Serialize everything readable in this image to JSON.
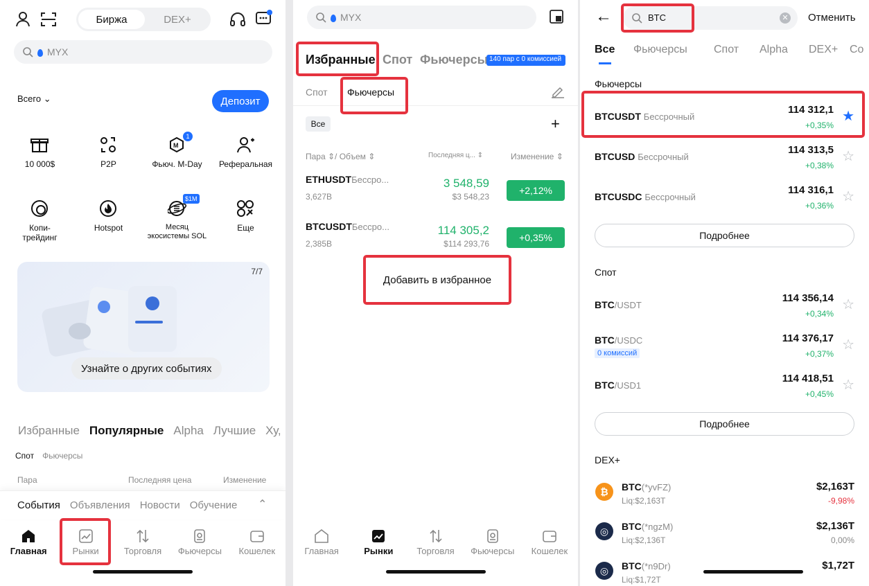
{
  "s1": {
    "seg": [
      "Биржа",
      "DEX+"
    ],
    "search": "MYX",
    "total": "Всего",
    "deposit": "Депозит",
    "grid": [
      {
        "label": "10 000$",
        "icon": "gift-icon"
      },
      {
        "label": "P2P",
        "icon": "p2p-icon"
      },
      {
        "label": "Фьюч. M-Day",
        "icon": "mday-icon",
        "badge": "1"
      },
      {
        "label": "Реферальная",
        "icon": "user-add-icon"
      },
      {
        "label": "Копи-\nтрейдинг",
        "icon": "copy-trading-icon"
      },
      {
        "label": "Hotspot",
        "icon": "hotspot-icon"
      },
      {
        "label": "Месяц\nэкосистемы SOL",
        "icon": "sol-month-icon",
        "badge": "$1M"
      },
      {
        "label": "Еще",
        "icon": "more-icon"
      }
    ],
    "banner": {
      "counter": "7/7",
      "cta": "Узнайте о других событиях"
    },
    "tabs": [
      "Избранные",
      "Популярные",
      "Alpha",
      "Лучшие",
      "Ху,"
    ],
    "subtabs": [
      "Спот",
      "Фьючерсы"
    ],
    "cols": [
      "Пара",
      "Последняя цена",
      "Изменение"
    ],
    "news": [
      "События",
      "Объявления",
      "Новости",
      "Обучение"
    ],
    "nav": [
      "Главная",
      "Рынки",
      "Торговля",
      "Фьючерсы",
      "Кошелек"
    ]
  },
  "s2": {
    "search": "MYX",
    "tabs": [
      "Избранные",
      "Спот",
      "Фьючерсы"
    ],
    "promo": "140 пар с 0 комиссией",
    "subtabs": [
      "Спот",
      "Фьючерсы"
    ],
    "filter": "Все",
    "cols": [
      "Пара ⇕/ Объем ⇕",
      "Последняя ц... ⇕",
      "Изменение ⇕"
    ],
    "rows": [
      {
        "pair": "ETHUSDT",
        "type": "Бессро...",
        "vol": "3,627B",
        "price": "3 548,59",
        "usd": "$3 548,23",
        "change": "+2,12%"
      },
      {
        "pair": "BTCUSDT",
        "type": "Бессро...",
        "vol": "2,385B",
        "price": "114 305,2",
        "usd": "$114 293,76",
        "change": "+0,35%"
      }
    ],
    "add": "Добавить в избранное",
    "nav": [
      "Главная",
      "Рынки",
      "Торговля",
      "Фьючерсы",
      "Кошелек"
    ]
  },
  "s3": {
    "query": "BTC",
    "cancel": "Отменить",
    "tabs": [
      "Все",
      "Фьючерсы",
      "Спот",
      "Alpha",
      "DEX+",
      "Co"
    ],
    "futures_title": "Фьючерсы",
    "futures": [
      {
        "pair": "BTCUSDT",
        "type": "Бессрочный",
        "price": "114 312,1",
        "change": "+0,35%",
        "fav": true
      },
      {
        "pair": "BTCUSD",
        "type": "Бессрочный",
        "price": "114 313,5",
        "change": "+0,38%",
        "fav": false
      },
      {
        "pair": "BTCUSDC",
        "type": "Бессрочный",
        "price": "114 316,1",
        "change": "+0,36%",
        "fav": false
      }
    ],
    "more": "Подробнее",
    "spot_title": "Спот",
    "spot": [
      {
        "base": "BTC",
        "quote": "/USDT",
        "price": "114 356,14",
        "change": "+0,34%",
        "tag": ""
      },
      {
        "base": "BTC",
        "quote": "/USDC",
        "price": "114 376,17",
        "change": "+0,37%",
        "tag": "0 комиссий"
      },
      {
        "base": "BTC",
        "quote": "/USD1",
        "price": "114 418,51",
        "change": "+0,45%",
        "tag": ""
      }
    ],
    "dex_title": "DEX+",
    "dex": [
      {
        "base": "BTC",
        "tag": "(*yvFZ)",
        "liq": "Liq:$2,163T",
        "price": "$2,163T",
        "change": "-9,98%",
        "color": "#f7931a"
      },
      {
        "base": "BTC",
        "tag": "(*ngzM)",
        "liq": "Liq:$2,136T",
        "price": "$2,136T",
        "change": "0,00%",
        "color": "#1b2a4a"
      },
      {
        "base": "BTC",
        "tag": "(*n9Dr)",
        "liq": "Liq:$1,72T",
        "price": "$1,72T",
        "change": "",
        "color": "#1b2a4a"
      }
    ]
  },
  "colors": {
    "accent": "#1f6fff",
    "up": "#20b26b",
    "down": "#e5323e",
    "highlight": "#e5323e"
  }
}
